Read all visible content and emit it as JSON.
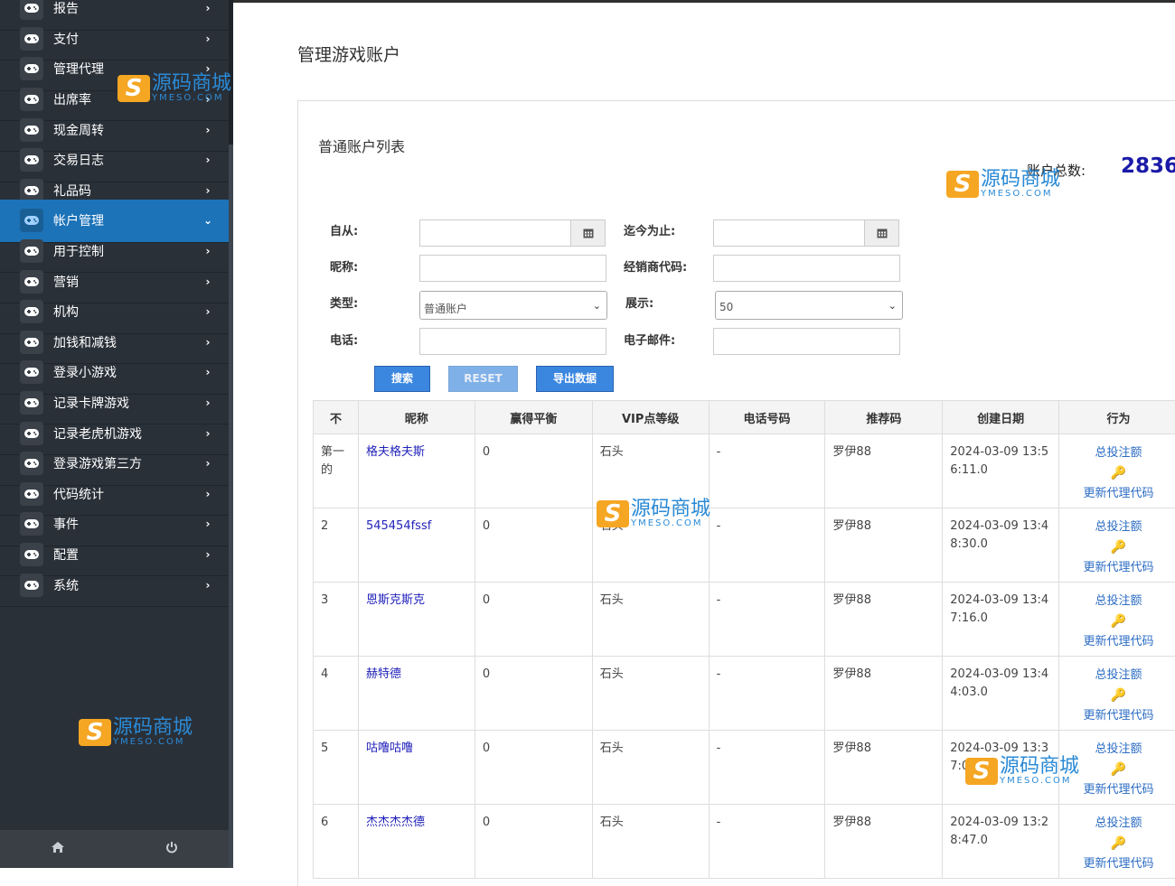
{
  "sidebar": {
    "items": [
      {
        "label": "报告",
        "active": false
      },
      {
        "label": "支付",
        "active": false
      },
      {
        "label": "管理代理",
        "active": false
      },
      {
        "label": "出席率",
        "active": false
      },
      {
        "label": "现金周转",
        "active": false
      },
      {
        "label": "交易日志",
        "active": false
      },
      {
        "label": "礼品码",
        "active": false
      },
      {
        "label": "帐户管理",
        "active": true
      },
      {
        "label": "用于控制",
        "active": false
      },
      {
        "label": "营销",
        "active": false
      },
      {
        "label": "机构",
        "active": false
      },
      {
        "label": "加钱和减钱",
        "active": false
      },
      {
        "label": "登录小游戏",
        "active": false
      },
      {
        "label": "记录卡牌游戏",
        "active": false
      },
      {
        "label": "记录老虎机游戏",
        "active": false
      },
      {
        "label": "登录游戏第三方",
        "active": false
      },
      {
        "label": "代码统计",
        "active": false
      },
      {
        "label": "事件",
        "active": false
      },
      {
        "label": "配置",
        "active": false
      },
      {
        "label": "系统",
        "active": false
      }
    ],
    "icon": "gamepad-icon",
    "footer": [
      "home-icon",
      "power-icon"
    ]
  },
  "page": {
    "title": "管理游戏账户",
    "panel_title": "普通账户列表",
    "total_label": "账户总数:",
    "total_value": "2836"
  },
  "filters": {
    "from_label": "自从:",
    "until_label": "迄今为止:",
    "nickname_label": "昵称:",
    "dealer_label": "经销商代码:",
    "type_label": "类型:",
    "type_value": "普通账户",
    "show_label": "展示:",
    "show_value": "50",
    "phone_label": "电话:",
    "email_label": "电子邮件:",
    "from_value": "",
    "until_value": "",
    "nickname_value": "",
    "dealer_value": "",
    "phone_value": "",
    "email_value": ""
  },
  "buttons": {
    "search": "搜索",
    "reset": "RESET",
    "export": "导出数据"
  },
  "table": {
    "headers": [
      "不",
      "昵称",
      "赢得平衡",
      "VIP点等级",
      "电话号码",
      "推荐码",
      "创建日期",
      "行为"
    ],
    "action_total_bet": "总投注额",
    "action_update_code": "更新代理代码",
    "rows": [
      {
        "no": "第一的",
        "nick": "格夫格夫斯",
        "balance": "0",
        "vip": "石头",
        "phone": "-",
        "ref": "罗伊88",
        "created": "2024-03-09 13:56:11.0"
      },
      {
        "no": "2",
        "nick": "545454fssf",
        "balance": "0",
        "vip": "石头",
        "phone": "-",
        "ref": "罗伊88",
        "created": "2024-03-09 13:48:30.0"
      },
      {
        "no": "3",
        "nick": "恩斯克斯克",
        "balance": "0",
        "vip": "石头",
        "phone": "-",
        "ref": "罗伊88",
        "created": "2024-03-09 13:47:16.0"
      },
      {
        "no": "4",
        "nick": "赫特德",
        "balance": "0",
        "vip": "石头",
        "phone": "-",
        "ref": "罗伊88",
        "created": "2024-03-09 13:44:03.0"
      },
      {
        "no": "5",
        "nick": "咕噜咕噜",
        "balance": "0",
        "vip": "石头",
        "phone": "-",
        "ref": "罗伊88",
        "created": "2024-03-09 13:37:0"
      },
      {
        "no": "6",
        "nick": "杰杰杰杰德",
        "balance": "0",
        "vip": "石头",
        "phone": "-",
        "ref": "罗伊88",
        "created": "2024-03-09 13:28:47.0"
      }
    ]
  },
  "watermark": {
    "title": "源码商城",
    "sub": "YMESO.COM",
    "logo": "S"
  }
}
